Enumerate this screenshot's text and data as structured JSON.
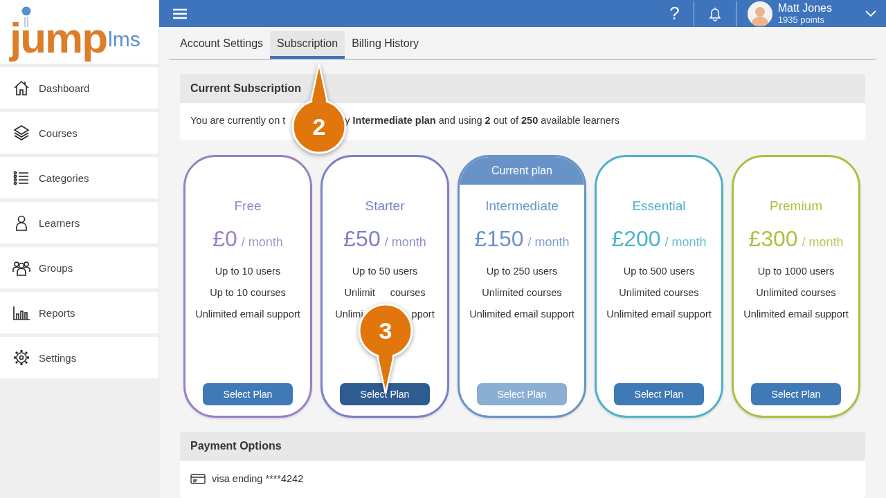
{
  "logo": {
    "main": "jump",
    "suffix": "lms"
  },
  "sidebar": {
    "items": [
      {
        "label": "Dashboard",
        "selected": false
      },
      {
        "label": "Courses",
        "selected": false
      },
      {
        "label": "Categories",
        "selected": false
      },
      {
        "label": "Learners",
        "selected": false
      },
      {
        "label": "Groups",
        "selected": false
      },
      {
        "label": "Reports",
        "selected": false
      },
      {
        "label": "Settings",
        "selected": false
      }
    ]
  },
  "topbar": {
    "help": "?",
    "user": {
      "name": "Matt Jones",
      "points": "1935 points"
    }
  },
  "tabs": [
    {
      "label": "Account Settings",
      "selected": false
    },
    {
      "label": "Subscription",
      "selected": true
    },
    {
      "label": "Billing History",
      "selected": false
    }
  ],
  "current_subscription": {
    "title": "Current Subscription",
    "text_parts": [
      "You are currently on t",
      "y **Intermediate plan** and using **2** out of **250** available learners"
    ]
  },
  "plans": [
    {
      "name": "Free",
      "color": "#9a80c6",
      "price": "£0",
      "period": "/ month",
      "features": [
        [
          "Up to 10 users"
        ],
        [
          "Up to 10 courses"
        ],
        [
          "Unlimited email support"
        ]
      ],
      "button": {
        "label": "Select Plan",
        "disabled": false,
        "pressed": false
      }
    },
    {
      "name": "Starter",
      "color": "#7c80c8",
      "price": "£50",
      "period": "/ month",
      "features": [
        [
          "Up to 50 users"
        ],
        [
          "Unlimit",
          "courses"
        ],
        [
          "Unlimi",
          "pport"
        ]
      ],
      "button": {
        "label": "Select Plan",
        "disabled": false,
        "pressed": true
      }
    },
    {
      "name": "Intermediate",
      "color": "#6893c8",
      "banner": "Current plan",
      "price": "£150",
      "period": "/ month",
      "features": [
        [
          "Up to 250 users"
        ],
        [
          "Unlimited courses"
        ],
        [
          "Unlimited email support"
        ]
      ],
      "button": {
        "label": "Select Plan",
        "disabled": true,
        "pressed": false
      }
    },
    {
      "name": "Essential",
      "color": "#4fb2c7",
      "price": "£200",
      "period": "/ month",
      "features": [
        [
          "Up to 500 users"
        ],
        [
          "Unlimited courses"
        ],
        [
          "Unlimited email support"
        ]
      ],
      "button": {
        "label": "Select Plan",
        "disabled": false,
        "pressed": false
      }
    },
    {
      "name": "Premium",
      "color": "#a9c241",
      "price": "£300",
      "period": "/ month",
      "features": [
        [
          "Up to 1000 users"
        ],
        [
          "Unlimited courses"
        ],
        [
          "Unlimited email support"
        ]
      ],
      "button": {
        "label": "Select Plan",
        "disabled": false,
        "pressed": false
      }
    }
  ],
  "payment_options": {
    "title": "Payment Options",
    "card": "visa ending ****4242"
  },
  "markers": [
    {
      "label": "2"
    },
    {
      "label": "3"
    }
  ]
}
